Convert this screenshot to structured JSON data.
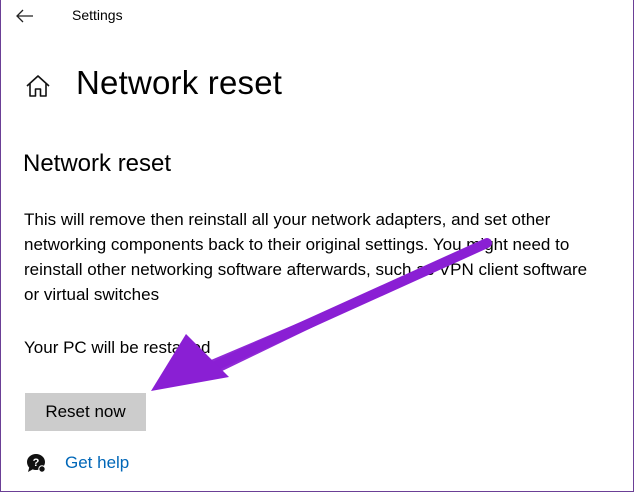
{
  "titlebar": {
    "app_title": "Settings",
    "back_icon": "back-arrow-icon"
  },
  "page": {
    "title": "Network reset",
    "home_icon": "home-icon"
  },
  "section": {
    "title": "Network reset",
    "description": "This will remove then reinstall all your network adapters, and set other networking components back to their original settings. You might need to reinstall other networking software afterwards, such as VPN client software or virtual switches",
    "restart_note": "Your PC will be restarted"
  },
  "actions": {
    "reset_label": "Reset now"
  },
  "help": {
    "icon": "chat-help-icon",
    "label": "Get help"
  },
  "colors": {
    "accent_link": "#0067b8",
    "button_bg": "#cccccc",
    "annotation_arrow": "#8a1fd4"
  }
}
